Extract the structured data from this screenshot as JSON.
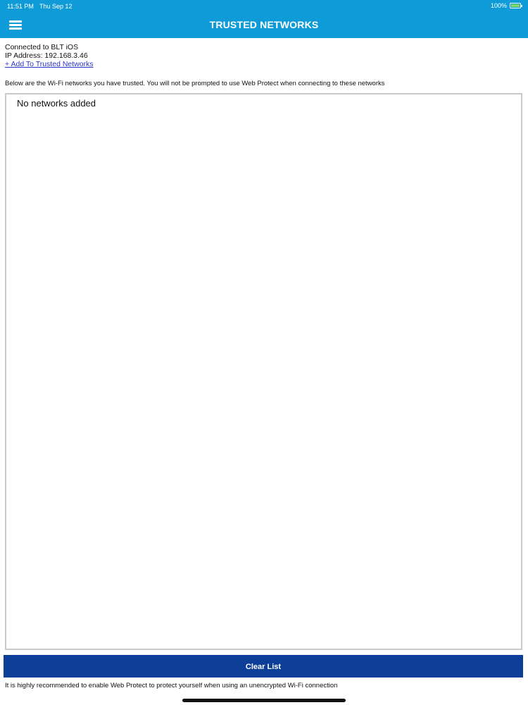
{
  "status_bar": {
    "time": "11:51 PM",
    "date": "Thu Sep 12",
    "battery_percent": "100%",
    "battery_level": 1.0
  },
  "nav": {
    "title": "TRUSTED NETWORKS",
    "menu_icon": "hamburger-menu-icon"
  },
  "connection": {
    "connected_to": "Connected to BLT iOS",
    "ip_address": "IP Address: 192.168.3.46",
    "add_link": "+ Add To Trusted Networks"
  },
  "description": "Below are the Wi-Fi networks you have trusted. You will not be prompted to use Web Protect when connecting to these networks",
  "network_list": {
    "empty_text": "No networks added",
    "items": []
  },
  "clear_button_label": "Clear List",
  "footer_note": "It is highly recommended to enable Web Protect to protect yourself when using an unencrypted Wi-Fi connection",
  "colors": {
    "header": "#0f9bd7",
    "button": "#0d3f99",
    "link": "#2a34c9"
  }
}
